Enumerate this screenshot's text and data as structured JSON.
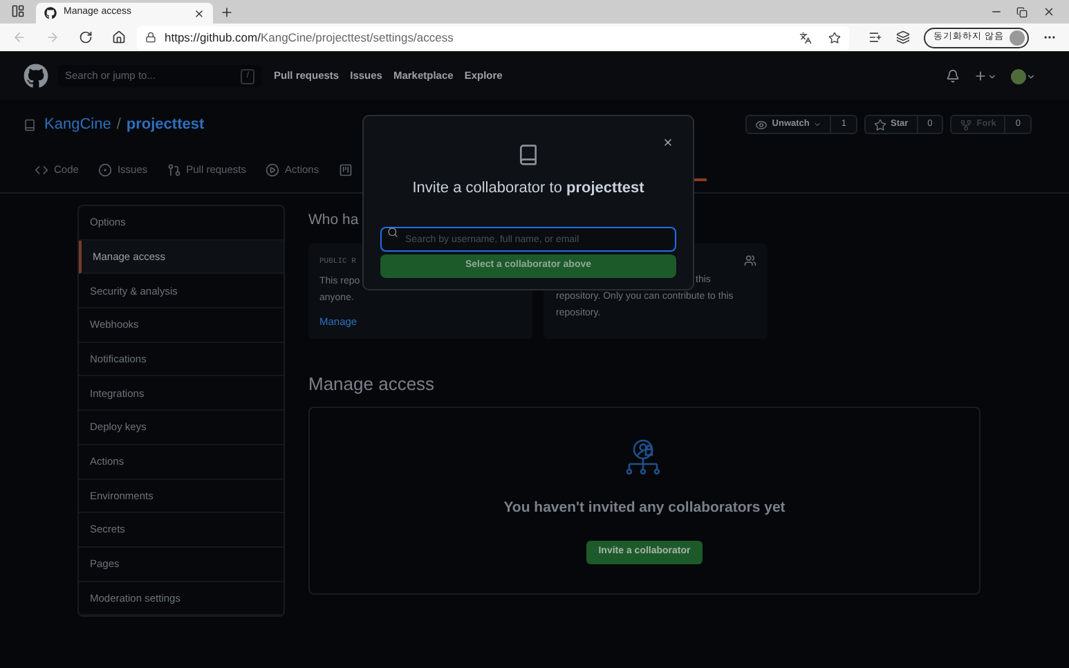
{
  "browser": {
    "tab_title": "Manage access",
    "url_host": "https://github.com/",
    "url_path": "KangCine/projecttest/settings/access",
    "profile_label": "동기화하지 않음"
  },
  "header": {
    "search_placeholder": "Search or jump to...",
    "search_key": "/",
    "nav": [
      "Pull requests",
      "Issues",
      "Marketplace",
      "Explore"
    ]
  },
  "repo": {
    "owner": "KangCine",
    "separator": "/",
    "name": "projecttest",
    "buttons": [
      {
        "kind": "watch",
        "label": "Unwatch",
        "count": "1",
        "disabled": false
      },
      {
        "kind": "star",
        "label": "Star",
        "count": "0",
        "disabled": false
      },
      {
        "kind": "fork",
        "label": "Fork",
        "count": "0",
        "disabled": true
      }
    ],
    "tabs": [
      {
        "kind": "code",
        "label": "Code"
      },
      {
        "kind": "issues",
        "label": "Issues"
      },
      {
        "kind": "pulls",
        "label": "Pull requests"
      },
      {
        "kind": "actions",
        "label": "Actions"
      },
      {
        "kind": "projects"
      }
    ]
  },
  "sidebar": {
    "items": [
      {
        "label": "Options",
        "selected": false
      },
      {
        "label": "Manage access",
        "selected": true
      },
      {
        "label": "Security & analysis",
        "selected": false
      },
      {
        "label": "Webhooks",
        "selected": false
      },
      {
        "label": "Notifications",
        "selected": false
      },
      {
        "label": "Integrations",
        "selected": false
      },
      {
        "label": "Deploy keys",
        "selected": false
      },
      {
        "label": "Actions",
        "selected": false
      },
      {
        "label": "Environments",
        "selected": false
      },
      {
        "label": "Secrets",
        "selected": false
      },
      {
        "label": "Pages",
        "selected": false
      },
      {
        "label": "Moderation settings",
        "selected": false
      }
    ]
  },
  "who_has_access": {
    "heading": "Who ha",
    "public_card": {
      "label": "PUBLIC R",
      "lines": [
        "This repo",
        "anyone."
      ],
      "link": "Manage"
    },
    "direct_card": {
      "lines": [
        "this",
        "repository. Only you can contribute to this",
        "repository."
      ]
    }
  },
  "manage_access": {
    "heading": "Manage access",
    "empty_message": "You haven't invited any collaborators yet",
    "button": "Invite a collaborator"
  },
  "modal": {
    "title": "Invite a collaborator to **projecttest**",
    "search_placeholder": "Search by username, full name, or email",
    "button": "Select a collaborator above"
  }
}
